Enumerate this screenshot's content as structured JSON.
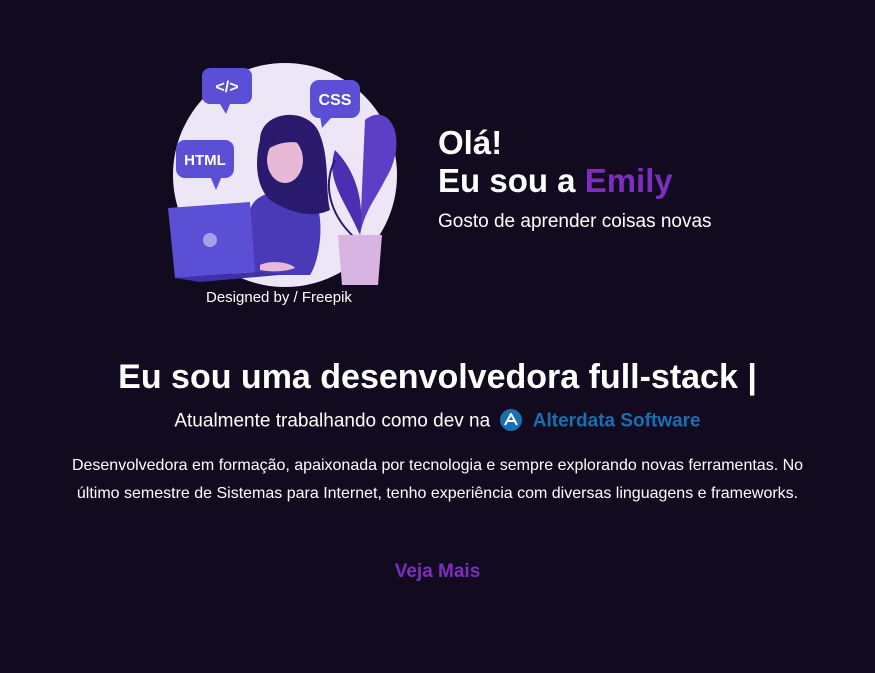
{
  "hero": {
    "credit": "Designed by / Freepik",
    "illustration_badges": [
      "</>",
      "CSS",
      "HTML"
    ],
    "greeting": "Olá!",
    "name_prefix": "Eu sou a ",
    "name": "Emily",
    "tagline": "Gosto de aprender coisas novas"
  },
  "about": {
    "headline": "Eu sou uma desenvolvedora full-stack |",
    "current_prefix": "Atualmente trabalhando como dev na",
    "company_name": "Alterdata Software",
    "bio": "Desenvolvedora em formação, apaixonada por tecnologia e sempre explorando novas ferramentas. No último semestre de Sistemas para Internet, tenho experiência com diversas linguagens e frameworks.",
    "more_label": "Veja Mais"
  },
  "colors": {
    "background": "#120a1f",
    "accent": "#7b2fbe",
    "company": "#1a6fae"
  }
}
